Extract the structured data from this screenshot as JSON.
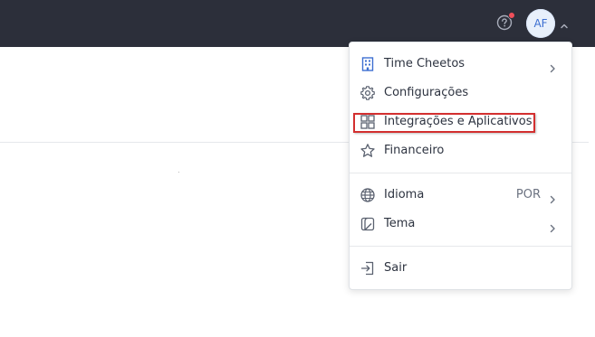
{
  "topbar": {
    "help_icon": "question-circle-icon",
    "notification_color": "#ef4f5a",
    "avatar_initials": "AF",
    "avatar_chevron_icon": "chevron-up-icon"
  },
  "menu": {
    "items": [
      {
        "label": "Time Cheetos",
        "icon": "building-icon",
        "has_submenu": true
      },
      {
        "label": "Configurações",
        "icon": "gear-icon",
        "has_submenu": false
      },
      {
        "label": "Integrações e Aplicativos",
        "icon": "grid-icon",
        "has_submenu": false,
        "highlighted": true
      },
      {
        "label": "Financeiro",
        "icon": "star-icon",
        "has_submenu": false
      },
      {
        "label": "Idioma",
        "icon": "globe-icon",
        "value": "POR",
        "has_submenu": true
      },
      {
        "label": "Tema",
        "icon": "theme-icon",
        "has_submenu": true
      },
      {
        "label": "Sair",
        "icon": "logout-icon",
        "has_submenu": false
      }
    ]
  },
  "colors": {
    "topbar_bg": "#2c2f3a",
    "accent": "#3d6fd1",
    "highlight_border": "#d32f2f"
  }
}
